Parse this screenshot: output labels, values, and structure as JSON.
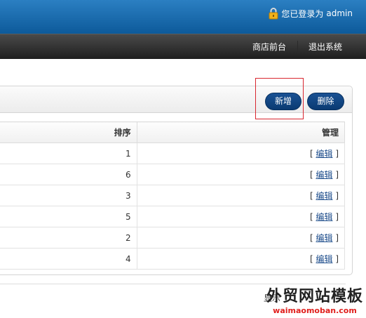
{
  "header": {
    "login_label": "您已登录为",
    "username": "admin"
  },
  "nav": {
    "storefront": "商店前台",
    "logout": "退出系统"
  },
  "toolbar": {
    "add": "新增",
    "delete": "删除"
  },
  "table": {
    "columns": [
      "排序",
      "管理"
    ],
    "rows": [
      {
        "order": "1",
        "edit": "编辑"
      },
      {
        "order": "6",
        "edit": "编辑"
      },
      {
        "order": "3",
        "edit": "编辑"
      },
      {
        "order": "5",
        "edit": "编辑"
      },
      {
        "order": "2",
        "edit": "编辑"
      },
      {
        "order": "4",
        "edit": "编辑"
      }
    ]
  },
  "footer": {
    "page_info": "显示"
  },
  "watermark": {
    "title": "外贸网站模板",
    "url": "waimaomoban.com"
  },
  "colors": {
    "header_blue": "#0d5a9a",
    "nav_dark": "#1e1e1e",
    "button_navy": "#0a3a72",
    "highlight_red": "#d8262f"
  }
}
